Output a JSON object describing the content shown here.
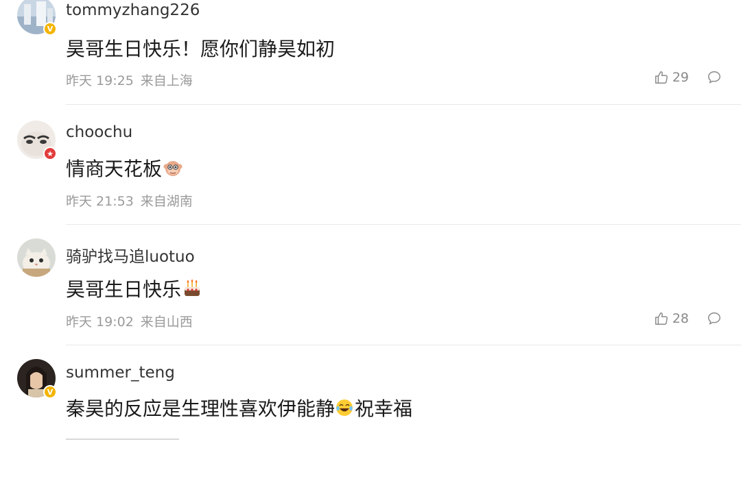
{
  "comments": [
    {
      "username": "tommyzhang226",
      "text": "昊哥生日快乐！愿你们静昊如初",
      "time": "昨天 19:25",
      "location": "来自上海",
      "likes": "29"
    },
    {
      "username": "choochu",
      "text": "情商天花板",
      "time": "昨天 21:53",
      "location": "来自湖南",
      "likes": ""
    },
    {
      "username": "骑驴找马追luotuo",
      "text": "昊哥生日快乐",
      "time": "昨天 19:02",
      "location": "来自山西",
      "likes": "28"
    },
    {
      "username": "summer_teng",
      "text_part1": "秦昊的反应是生理性喜欢伊能静",
      "text_part2": "祝幸福"
    }
  ],
  "icons": {
    "like": "thumbs-up-icon",
    "reply": "comment-bubble-icon",
    "verified_gold": "verified-badge-icon",
    "verified_red": "star-badge-icon"
  },
  "colors": {
    "badge_gold": "#f4b400",
    "badge_red": "#e23c3c",
    "meta_gray": "#9a9a9a"
  }
}
